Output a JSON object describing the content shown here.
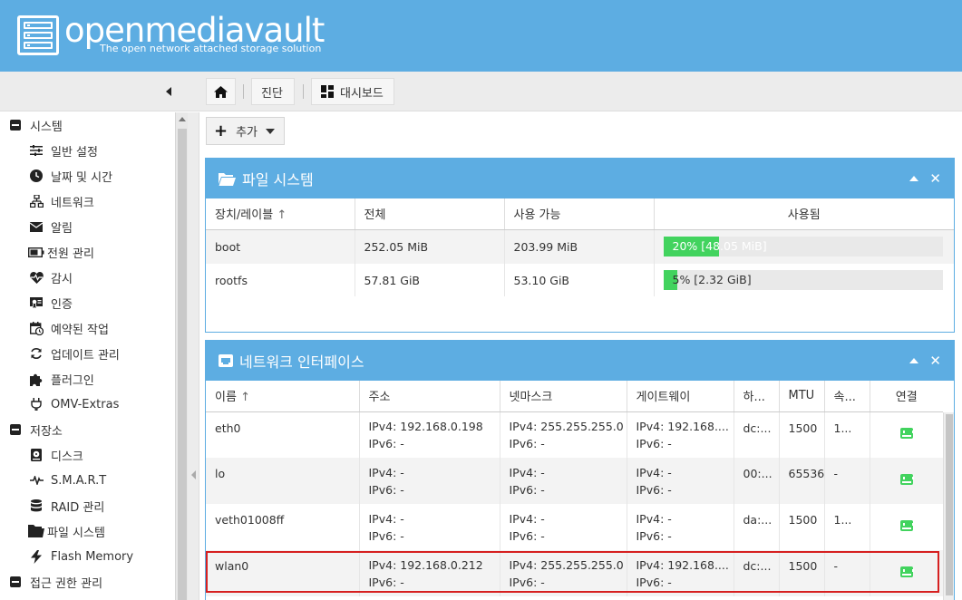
{
  "header": {
    "title": "openmediavault",
    "subtitle": "The open network attached storage solution"
  },
  "breadcrumb": {
    "home_icon": "home-icon",
    "items": [
      "진단",
      "대시보드"
    ],
    "dashboard_icon": "dashboard-grid-icon"
  },
  "sidebar": {
    "items": [
      {
        "label": "시스템",
        "icon": "minus-box-icon",
        "group": true
      },
      {
        "label": "일반 설정",
        "icon": "sliders-icon"
      },
      {
        "label": "날짜 및 시간",
        "icon": "clock-icon"
      },
      {
        "label": "네트워크",
        "icon": "network-icon"
      },
      {
        "label": "알림",
        "icon": "envelope-icon"
      },
      {
        "label": "전원 관리",
        "icon": "battery-icon"
      },
      {
        "label": "감시",
        "icon": "heartbeat-icon"
      },
      {
        "label": "인증",
        "icon": "certificate-icon"
      },
      {
        "label": "예약된 작업",
        "icon": "calendar-clock-icon"
      },
      {
        "label": "업데이트 관리",
        "icon": "refresh-icon"
      },
      {
        "label": "플러그인",
        "icon": "puzzle-icon"
      },
      {
        "label": "OMV-Extras",
        "icon": "plug-icon"
      },
      {
        "label": "저장소",
        "icon": "minus-box-icon",
        "group": true
      },
      {
        "label": "디스크",
        "icon": "hdd-icon"
      },
      {
        "label": "S.M.A.R.T",
        "icon": "pulse-icon"
      },
      {
        "label": "RAID 관리",
        "icon": "database-icon"
      },
      {
        "label": "파일 시스템",
        "icon": "folder-icon"
      },
      {
        "label": "Flash Memory",
        "icon": "bolt-icon"
      },
      {
        "label": "접근 권한 관리",
        "icon": "minus-box-icon",
        "group": true
      }
    ]
  },
  "toolbar": {
    "add_label": "추가"
  },
  "filesystem_panel": {
    "title": "파일 시스템",
    "columns": [
      "장치/레이블",
      "전체",
      "사용 가능",
      "사용됨"
    ],
    "sort_indicator": "↑",
    "rows": [
      {
        "device": "boot",
        "total": "252.05 MiB",
        "available": "203.99 MiB",
        "used_text": "20% [48.05 MiB]",
        "used_percent": 20
      },
      {
        "device": "rootfs",
        "total": "57.81 GiB",
        "available": "53.10 GiB",
        "used_text": "5% [2.32 GiB]",
        "used_percent": 5
      }
    ]
  },
  "network_panel": {
    "title": "네트워크 인터페이스",
    "columns": [
      "이름",
      "주소",
      "넷마스크",
      "게이트웨이",
      "하...",
      "MTU",
      "속...",
      "연결"
    ],
    "sort_indicator": "↑",
    "rows": [
      {
        "name": "eth0",
        "addr4": "IPv4: 192.168.0.198",
        "addr6": "IPv6: -",
        "mask4": "IPv4: 255.255.255.0",
        "mask6": "IPv6: -",
        "gw4": "IPv4: 192.168....",
        "gw6": "IPv6: -",
        "hw": "dc:...",
        "mtu": "1500",
        "speed": "1...",
        "link": "connected-icon"
      },
      {
        "name": "lo",
        "addr4": "IPv4: -",
        "addr6": "IPv6: -",
        "mask4": "IPv4: -",
        "mask6": "IPv6: -",
        "gw4": "IPv4: -",
        "gw6": "IPv6: -",
        "hw": "00:...",
        "mtu": "65536",
        "speed": "-",
        "link": "connected-icon"
      },
      {
        "name": "veth01008ff",
        "addr4": "IPv4: -",
        "addr6": "IPv6: -",
        "mask4": "IPv4: -",
        "mask6": "IPv6: -",
        "gw4": "IPv4: -",
        "gw6": "IPv6: -",
        "hw": "da:...",
        "mtu": "1500",
        "speed": "1...",
        "link": "connected-icon"
      },
      {
        "name": "wlan0",
        "addr4": "IPv4: 192.168.0.212",
        "addr6": "IPv6: -",
        "mask4": "IPv4: 255.255.255.0",
        "mask6": "IPv6: -",
        "gw4": "IPv4: 192.168....",
        "gw6": "IPv6: -",
        "hw": "dc:...",
        "mtu": "1500",
        "speed": "-",
        "link": "connected-icon"
      }
    ]
  },
  "colors": {
    "header_bg": "#5dade2",
    "usage_fill": "#42d35e",
    "highlight": "#d62020"
  }
}
